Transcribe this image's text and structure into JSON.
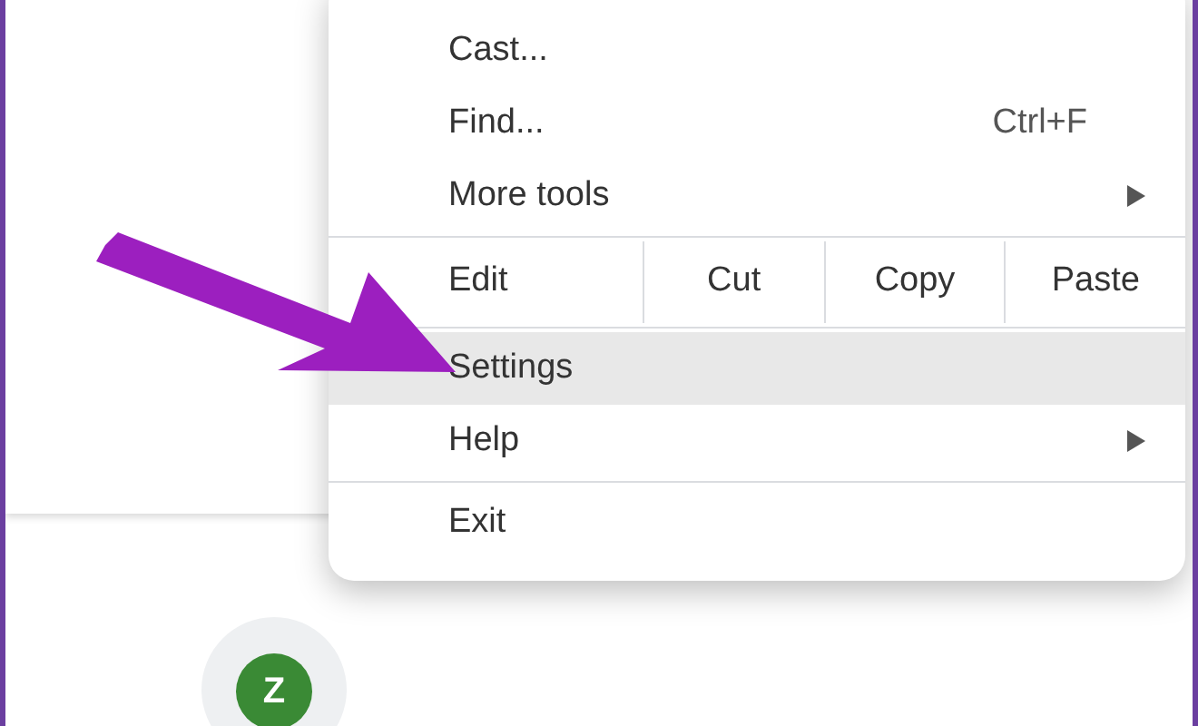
{
  "menu": {
    "items": [
      {
        "kind": "item",
        "label": "Cast...",
        "selected": false
      },
      {
        "kind": "item",
        "label": "Find...",
        "shortcut": "Ctrl+F",
        "selected": false
      },
      {
        "kind": "item",
        "label": "More tools",
        "submenu": true,
        "selected": false
      },
      {
        "kind": "divider"
      },
      {
        "kind": "edit_row",
        "label": "Edit",
        "actions": [
          "Cut",
          "Copy",
          "Paste"
        ]
      },
      {
        "kind": "divider"
      },
      {
        "kind": "item",
        "label": "Settings",
        "selected": true
      },
      {
        "kind": "item",
        "label": "Help",
        "submenu": true,
        "selected": false
      },
      {
        "kind": "divider"
      },
      {
        "kind": "item",
        "label": "Exit",
        "selected": false
      }
    ]
  },
  "avatar": {
    "letter": "Z"
  }
}
